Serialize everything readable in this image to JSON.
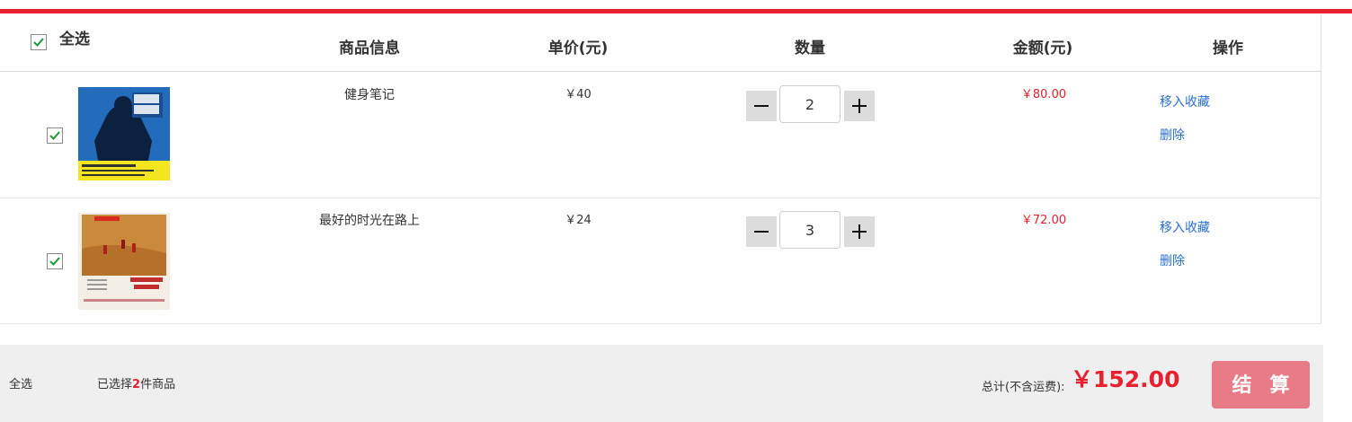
{
  "header": {
    "select_all_label": "全选",
    "col_product": "商品信息",
    "col_price": "单价(元)",
    "col_quantity": "数量",
    "col_amount": "金额(元)",
    "col_action": "操作"
  },
  "items": [
    {
      "name": "健身笔记",
      "price": "￥40",
      "quantity": "2",
      "amount": "￥80.00",
      "favorite_label": "移入收藏",
      "delete_label": "删除",
      "checked": true
    },
    {
      "name": "最好的时光在路上",
      "price": "￥24",
      "quantity": "3",
      "amount": "￥72.00",
      "favorite_label": "移入收藏",
      "delete_label": "删除",
      "checked": true
    }
  ],
  "footer": {
    "select_all_label": "全选",
    "selected_prefix": "已选择",
    "selected_count": "2",
    "selected_suffix": "件商品",
    "total_label": "总计(不含运费):",
    "total_value": "￥152.00",
    "checkout_label": "结算"
  },
  "colors": {
    "accent": "#e8202f",
    "checkout_button": "#e77c86",
    "link": "#2a6fd6",
    "check_mark": "#1a9a3a"
  },
  "icons": {
    "checkbox": "check-icon",
    "minus": "minus-icon",
    "plus": "plus-icon"
  }
}
